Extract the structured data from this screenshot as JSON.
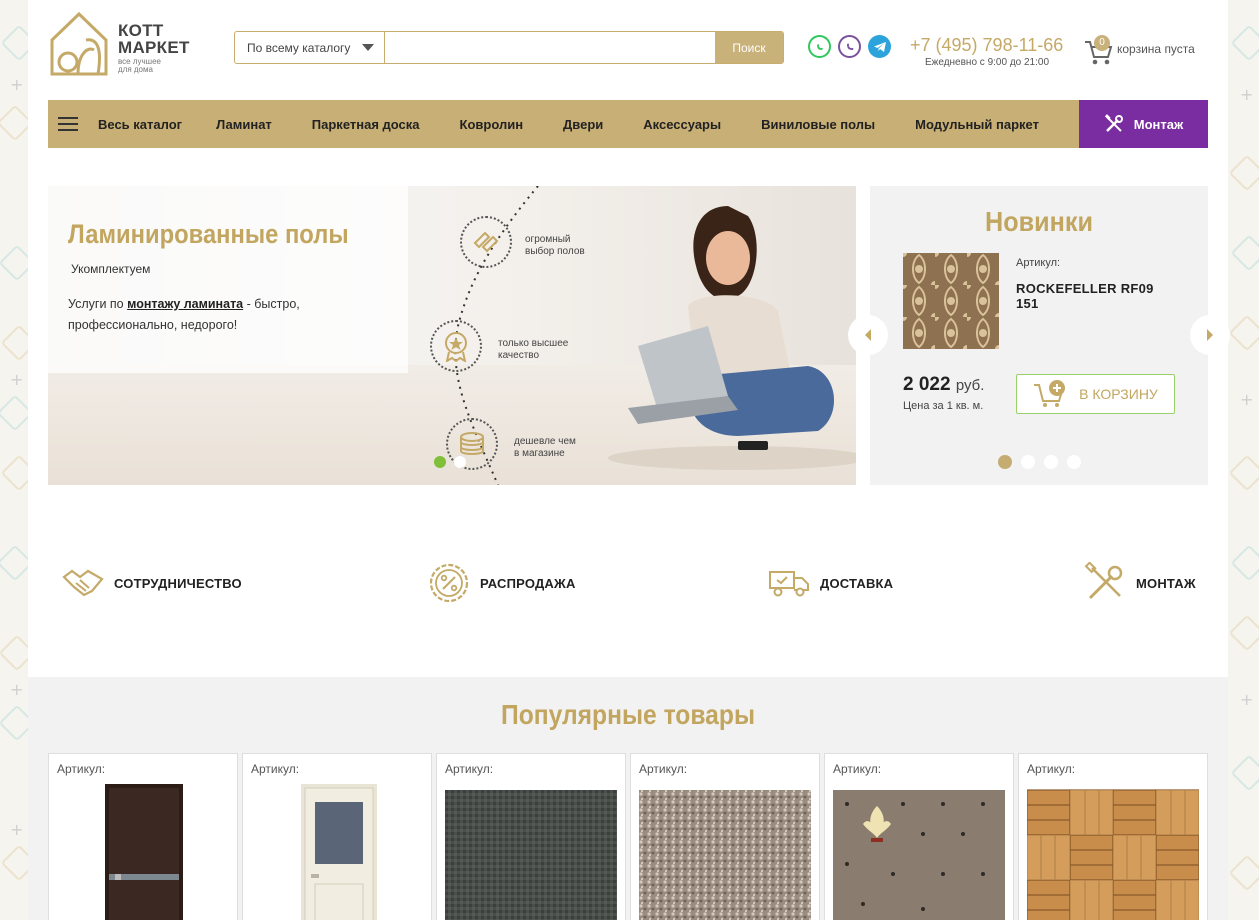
{
  "header": {
    "logo_title_line1": "КОТТ",
    "logo_title_line2": "МАРКЕТ",
    "logo_sub_line1": "все лучшее",
    "logo_sub_line2": "для дома",
    "search_scope": "По всему каталогу",
    "search_placeholder": "",
    "search_button": "Поиск",
    "phone": "+7 (495) 798-11-66",
    "hours": "Ежедневно с 9:00 до 21:00",
    "cart_count": "0",
    "cart_text": "корзина пуста"
  },
  "nav": {
    "items": [
      "Весь каталог",
      "Ламинат",
      "Паркетная доска",
      "Ковролин",
      "Двери",
      "Аксессуары",
      "Виниловые полы",
      "Модульный паркет"
    ],
    "mount": "Монтаж"
  },
  "banner": {
    "title": "Ламинированные полы",
    "subtitle": "Укомплектуем",
    "desc_prefix": "Услуги по ",
    "desc_link": "монтажу ламината",
    "desc_suffix": " - быстро, профессионально, недорого!",
    "features": [
      {
        "line1": "огромный",
        "line2": "выбор полов",
        "icon": "parquet-icon"
      },
      {
        "line1": "только высшее",
        "line2": "качество",
        "icon": "medal-icon"
      },
      {
        "line1": "дешевле чем",
        "line2": "в магазине",
        "icon": "coins-icon"
      }
    ],
    "slides": 2,
    "active_slide": 1
  },
  "novinki": {
    "title": "Новинки",
    "article_label": "Артикул:",
    "article_line1": "ROCKEFELLER RF09",
    "article_line2": "151",
    "price": "2 022",
    "currency": "руб.",
    "unit": "Цена за 1 кв. м.",
    "cart_button": "В КОРЗИНУ",
    "slides": 4,
    "active_slide": 1
  },
  "services": [
    "СОТРУДНИЧЕСТВО",
    "РАСПРОДАЖА",
    "ДОСТАВКА",
    "МОНТАЖ"
  ],
  "popular": {
    "title": "Популярные товары",
    "article_label": "Артикул:",
    "products": [
      {
        "kind": "door-dark"
      },
      {
        "kind": "door-light"
      },
      {
        "kind": "carpet-dark"
      },
      {
        "kind": "carpet-beige"
      },
      {
        "kind": "carpet-pattern"
      },
      {
        "kind": "parquet"
      }
    ]
  },
  "colors": {
    "gold": "#c2a660",
    "nav": "#c8af75",
    "purple": "#7a2da0",
    "green": "#7fbf3a"
  }
}
